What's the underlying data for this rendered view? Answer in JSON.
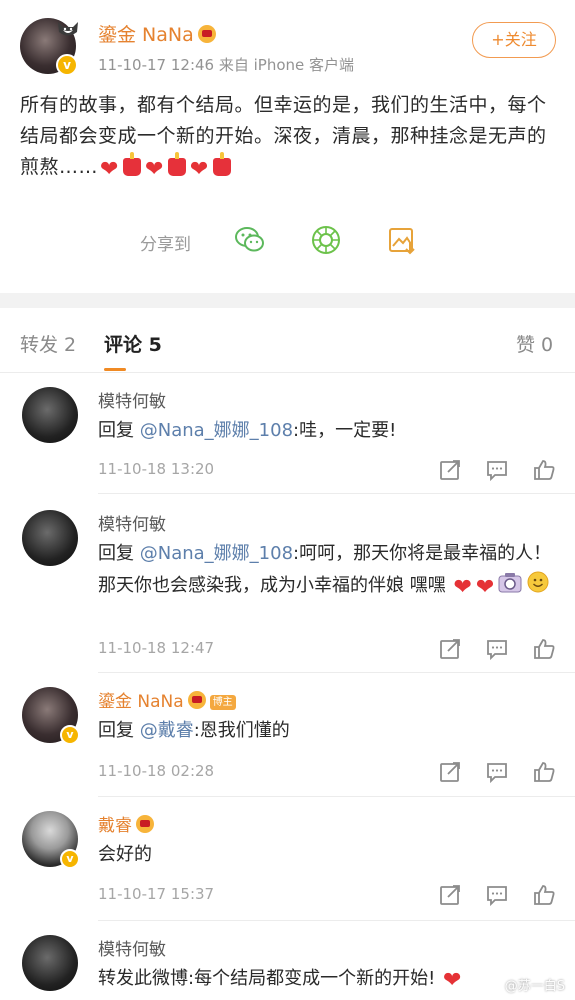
{
  "post": {
    "author": "鎏金 NaNa",
    "meta": "11-10-17 12:46  来自 iPhone 客户端",
    "follow_label": "+关注",
    "text": "所有的故事，都有个结局。但幸运的是，我们的生活中，每个结局都会变成一个新的开始。深夜，清晨，那种挂念是无声的煎熬……",
    "share_label": "分享到",
    "share_icons": [
      "wechat-icon",
      "moments-icon",
      "save-image-icon"
    ]
  },
  "tabs": {
    "repost": "转发 2",
    "comments": "评论 5",
    "likes": "赞 0"
  },
  "comments": [
    {
      "name": "模特何敏",
      "prefix": "回复 ",
      "mention": "@Nana_娜娜_108",
      "text": ":哇，一定要!",
      "time": "11-10-18 13:20"
    },
    {
      "name": "模特何敏",
      "prefix": "回复 ",
      "mention": "@Nana_娜娜_108",
      "text": ":呵呵，那天你将是最幸福的人！那天你也会感染我，成为小幸福的伴娘 嘿嘿",
      "time": "11-10-18 12:47"
    },
    {
      "name": "鎏金 NaNa",
      "badge": "博主",
      "prefix": "回复 ",
      "mention": "@戴睿",
      "text": ":恩我们懂的",
      "time": "11-10-18 02:28"
    },
    {
      "name": "戴睿",
      "text": "会好的",
      "time": "11-10-17 15:37"
    },
    {
      "name": "模特何敏",
      "text": "转发此微博:每个结局都变成一个新的开始!"
    }
  ],
  "actions": [
    "share-icon",
    "comment-icon",
    "like-icon"
  ],
  "watermark": "@苏一白S",
  "colors": {
    "accent_orange": "#e5822f",
    "mention_blue": "#5d7fab",
    "tab_underline": "#f08a24",
    "heart_red": "#e53236"
  }
}
